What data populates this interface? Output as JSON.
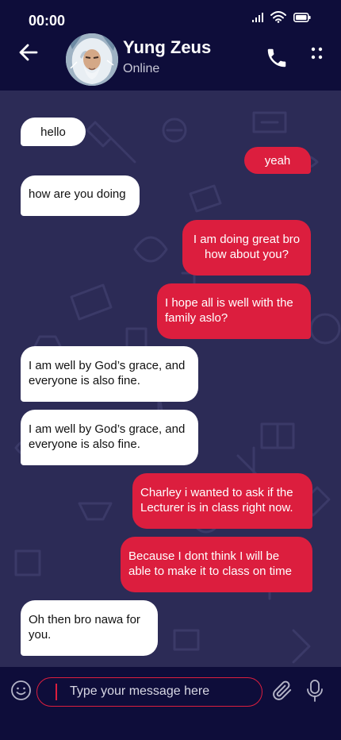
{
  "status_bar": {
    "time": "00:00"
  },
  "header": {
    "contact_name": "Yung Zeus",
    "contact_status": "Online"
  },
  "colors": {
    "header_bg": "#0e0d3a",
    "chat_bg": "#2c2b56",
    "outgoing_bubble": "#dc1e3e",
    "incoming_bubble": "#ffffff",
    "accent": "#dc1e3e"
  },
  "icons": {
    "back": "arrow-left-icon",
    "call": "phone-icon",
    "menu": "dots-menu-icon",
    "emoji": "smiley-icon",
    "attach": "paperclip-icon",
    "mic": "microphone-icon"
  },
  "messages": [
    {
      "direction": "in",
      "text": "hello"
    },
    {
      "direction": "out",
      "text": "yeah"
    },
    {
      "direction": "in",
      "text": "how are you doing"
    },
    {
      "direction": "out",
      "text": "I am doing great bro\n how about you?"
    },
    {
      "direction": "out",
      "text": "I hope all is well with the family aslo?"
    },
    {
      "direction": "in",
      "text": "I am well by God’s grace, and everyone is also fine."
    },
    {
      "direction": "in",
      "text": "I am well by God’s grace, and everyone is also fine."
    },
    {
      "direction": "out",
      "text": "Charley i wanted to ask if the Lecturer is in class right now."
    },
    {
      "direction": "out",
      "text": "Because I dont think I will be able to make it to class on time"
    },
    {
      "direction": "in",
      "text": "Oh then bro nawa for you."
    }
  ],
  "input": {
    "placeholder": "Type your message here",
    "value": ""
  }
}
